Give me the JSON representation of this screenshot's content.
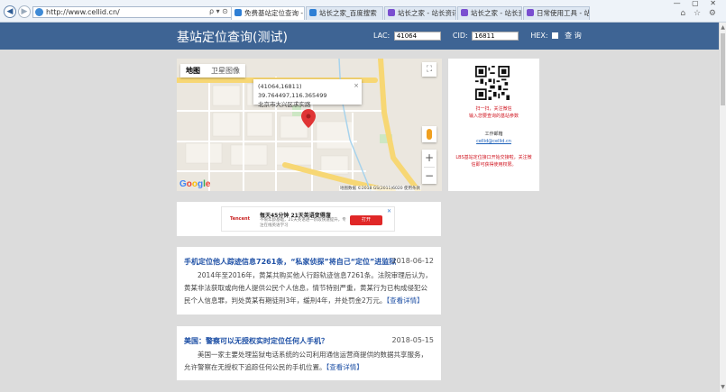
{
  "browser": {
    "url": "http://www.cellid.cn/",
    "address_tools": "ρ ▾ ⊙ ✕",
    "tabs": [
      {
        "label": "免费基站定位查询 - 通过lac..."
      },
      {
        "label": "站长之家_百度搜索"
      },
      {
        "label": "站长之家 - 站长资讯 | 网站数..."
      },
      {
        "label": "站长之家 - 站长资讯 | 网站数..."
      },
      {
        "label": "日常使用工具 - 站长工具"
      }
    ],
    "tab_icon_colors": [
      "#2e7fd5",
      "#2e7fd5",
      "#7a4fd0",
      "#7a4fd0",
      "#7a4fd0"
    ],
    "window_buttons": "— ▢ ✕",
    "right_icons": "⌂ ☆ ⚙"
  },
  "header": {
    "title": "基站定位查询(测试)",
    "lac_label": "LAC:",
    "lac_value": "41064",
    "cid_label": "CID:",
    "cid_value": "16811",
    "hex_label": "HEX:",
    "query_button": "查 询"
  },
  "map": {
    "type_map": "地图",
    "type_satellite": "卫星图像",
    "info_coords": "(41064,16811) 39.764497,116.365499",
    "info_address": "北京市大兴区求实路",
    "info_close": "×",
    "fullscreen": "⛶",
    "zoom_in": "+",
    "zoom_out": "−",
    "google_logo": [
      "G",
      "o",
      "o",
      "g",
      "l",
      "e"
    ],
    "google_colors": [
      "#4285f4",
      "#ea4335",
      "#fbbc05",
      "#4285f4",
      "#34a853",
      "#ea4335"
    ],
    "attribution": "地图数据 ©2018 GS(2011)6020  使用条款",
    "road_color": "#f7d774",
    "water_color": "#a8d3ec",
    "marker_color": "#e03535"
  },
  "qr_panel": {
    "line1": "扫一扫，关注微信",
    "line2": "输入您要查询的基站参数",
    "contact_label": "工作邮箱",
    "email": "cellid@cellid.cn",
    "line3": "LBS基站定位接口开始交接啦，关注微信即可获得使用权限。"
  },
  "ad": {
    "logo": "Tencent",
    "title": "每天45分钟 21天英语变得溜",
    "desc": "不限年龄基础，21天英语进一阶段快速提升，专注在线英语学习",
    "button": "打开",
    "close": "✕"
  },
  "news": [
    {
      "title": "手机定位他人踪迹信息7261条，“私家侦探”将自己“定位”进监狱",
      "date": "2018-06-12",
      "body": "2014年至2016年，黄某共购买他人行踪轨迹信息7261条。法院审理后认为，黄某非法获取或向他人提供公民个人信息，情节特别严重，黄某行为已构成侵犯公民个人信息罪，判处黄某有期徒刑3年，缓刑4年，并处罚金2万元。",
      "more": "【查看详情】"
    },
    {
      "title": "美国：警察可以无授权实时定位任何人手机？",
      "date": "2018-05-15",
      "body": "美国一家主要处理监狱电话系统的公司利用通信运营商提供的数据共享服务，允许警察在无授权下追踪任何公民的手机位置。",
      "more": "【查看详情】"
    }
  ]
}
